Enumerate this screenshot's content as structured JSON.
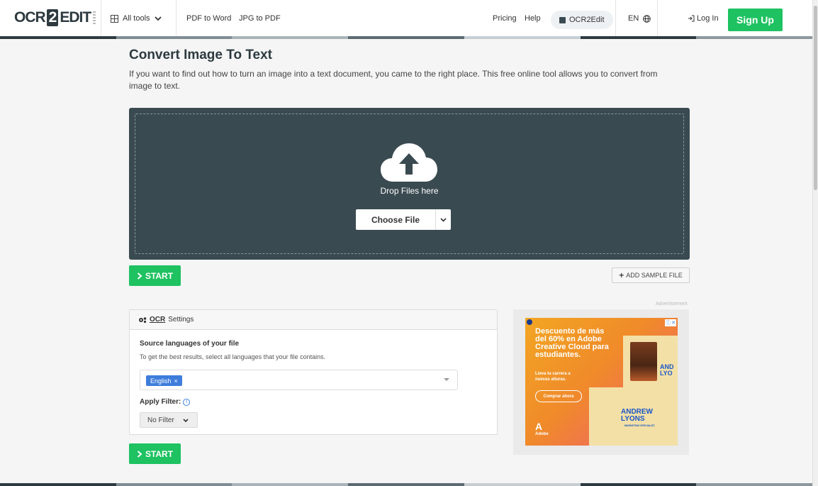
{
  "header": {
    "logo": {
      "left": "OCR",
      "middle": "2",
      "right": "EDIT"
    },
    "all_tools": "All tools",
    "links": [
      "PDF to Word",
      "JPG to PDF"
    ],
    "pricing": "Pricing",
    "help": "Help",
    "ocr2edit": "OCR2Edit",
    "language": "EN",
    "login": "Log In",
    "signup": "Sign Up"
  },
  "main": {
    "title": "Convert Image To Text",
    "description": "If you want to find out how to turn an image into a text document, you came to the right place. This free online tool allows you to convert from image to text.",
    "drop_text": "Drop Files here",
    "choose_file": "Choose File",
    "start": "START",
    "add_sample": "ADD SAMPLE FILE"
  },
  "settings": {
    "title_ocr": "OCR",
    "title_rest": "Settings",
    "source_label": "Source languages of your file",
    "source_hint": "To get the best results, select all languages that your file contains.",
    "selected_language": "English",
    "filter_label": "Apply Filter:",
    "filter_value": "No Filter"
  },
  "ad": {
    "label": "Advertisement",
    "headline": "Descuento de más del 60% en Adobe Creative Cloud para estudiantes.",
    "sub": "Lleva tu carrera a nuevas alturas.",
    "cta": "Comprar ahora",
    "name": "ANDREW LYONS",
    "name_partial_1": "AND",
    "name_partial_2": "LYO",
    "role": "MARKETING SPECIALIST",
    "brand": "Adobe"
  },
  "colors": {
    "accent_green": "#1ec261",
    "dropzone": "#3a4a51",
    "tag_blue": "#3e7ddb",
    "stripe": [
      "#2d3a40",
      "#7f8c93",
      "#a9b3b8",
      "#5c6a71",
      "#c6ced2"
    ]
  }
}
